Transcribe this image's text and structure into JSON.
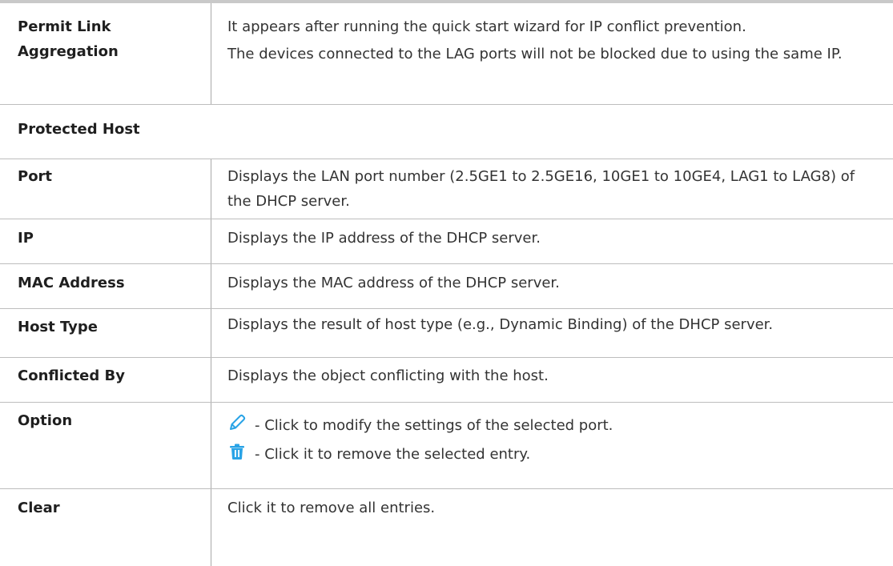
{
  "top_row": {
    "name": "Permit Link Aggregation",
    "desc": [
      "It appears after running the quick start wizard for IP conflict prevention.",
      "The devices connected to the LAG ports will not be blocked due to using the same IP."
    ]
  },
  "section_title": "Protected Host",
  "rows": [
    {
      "name": "Port",
      "desc": "Displays the LAN port number (2.5GE1 to 2.5GE16, 10GE1 to 10GE4, LAG1 to LAG8) of the DHCP server."
    },
    {
      "name": "IP",
      "desc": "Displays the IP address of the DHCP server."
    },
    {
      "name": "MAC Address",
      "desc": "Displays the MAC address of the DHCP server."
    },
    {
      "name": "Host Type",
      "desc": "Displays the result of host type (e.g., Dynamic Binding) of the DHCP server."
    },
    {
      "name": "Conflicted By",
      "desc": "Displays the object conflicting with the host."
    }
  ],
  "option_row": {
    "name": "Option",
    "edit_text": "- Click to modify the settings of the selected port.",
    "delete_text": "- Click it to remove the selected entry.",
    "edit_icon": "pencil-icon",
    "delete_icon": "trash-icon",
    "icon_color": "#29a3e6"
  },
  "clear_row": {
    "name": "Clear",
    "desc": "Click it to remove all entries."
  }
}
